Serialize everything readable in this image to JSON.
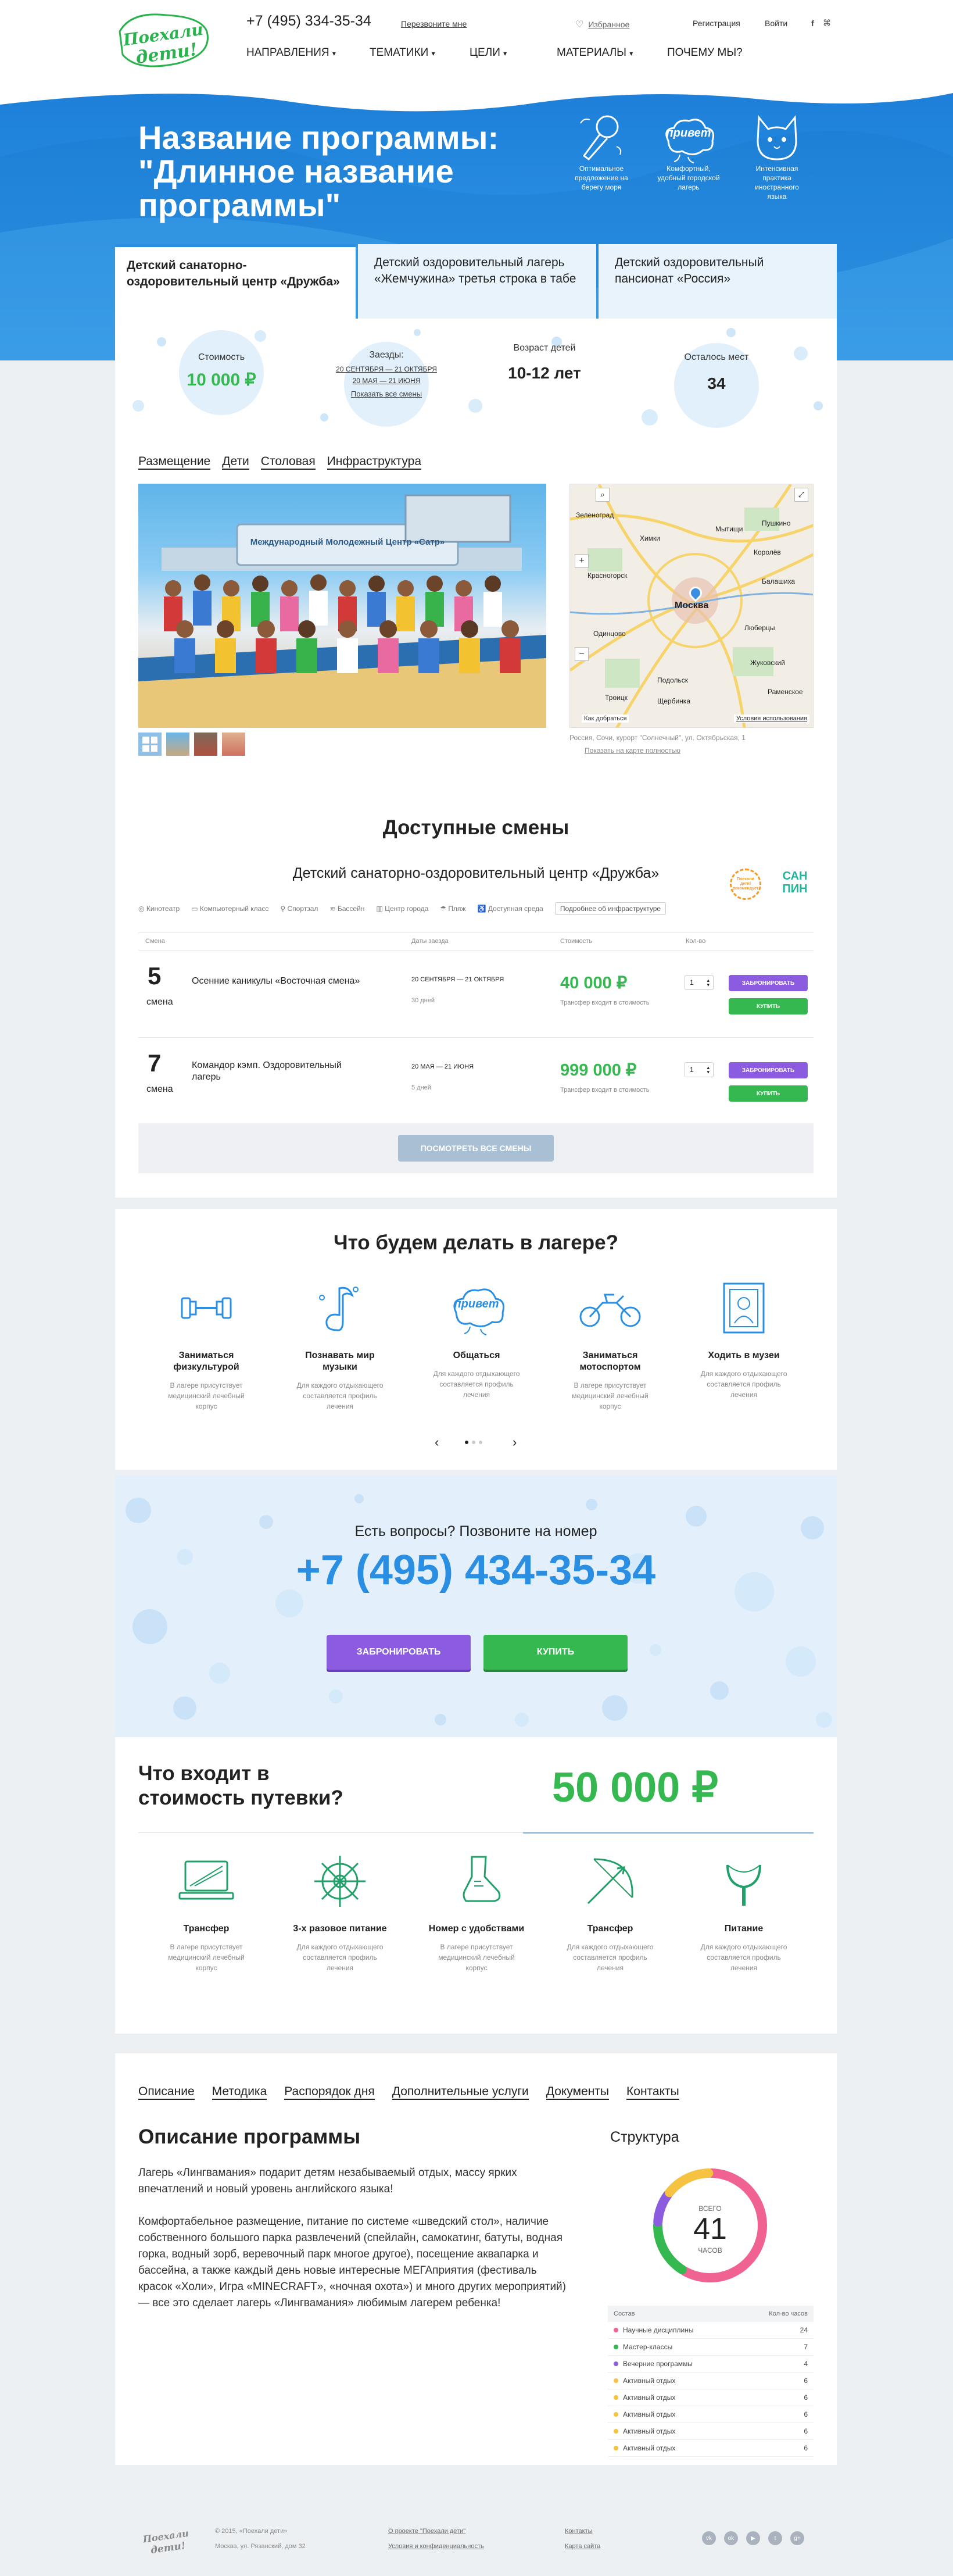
{
  "header": {
    "logo_text": "Поехали дети!",
    "phone": "+7 (495) 334-35-34",
    "callback": "Перезвоните мне",
    "favorites": "Избранное",
    "register": "Регистрация",
    "login": "Войти",
    "nav": [
      "НАПРАВЛЕНИЯ",
      "ТЕМАТИКИ",
      "ЦЕЛИ",
      "МАТЕРИАЛЫ",
      "ПОЧЕМУ МЫ?"
    ]
  },
  "hero": {
    "title": "Название программы: \"Длинное название программы\"",
    "features": [
      {
        "icon": "microphone-icon",
        "text": "Оптимальное предложение на берегу моря"
      },
      {
        "icon": "privet-cloud-icon",
        "badge": "привет",
        "text": "Комфортный, удобный городской лагерь"
      },
      {
        "icon": "cat-icon",
        "text": "Интенсивная практика иностранного языка"
      }
    ]
  },
  "tabs": [
    "Детский санаторно-оздоровительный центр «Дружба»",
    "Детский оздоровительный лагерь «Жемчужина» третья строка в табе",
    "Детский оздоровительный пансионат «Россия»"
  ],
  "stats": {
    "price_label": "Стоимость",
    "price_value": "10 000 ₽",
    "sessions_label": "Заезды:",
    "session_1": "20 СЕНТЯБРЯ — 21 ОКТЯБРЯ",
    "session_2": "20 МАЯ — 21 ИЮНЯ",
    "show_all": "Показать все смены",
    "age_label": "Возраст детей",
    "age_value": "10-12 лет",
    "places_label": "Осталось мест",
    "places_value": "34"
  },
  "sub_tabs": [
    "Размещение",
    "Дети",
    "Столовая",
    "Инфраструктура"
  ],
  "photo": {
    "banner": "Международный Молодежный Центр «Сатр»"
  },
  "map": {
    "address": "Россия, Сочи, курорт \"Солнечный\", ул. Октябрьская, 1",
    "link": "Показать на карте полностью",
    "labels": [
      "Зеленоград",
      "Мытищи",
      "Химки",
      "Пушкино",
      "Королёв",
      "Красногорск",
      "Балашиха",
      "Москва",
      "Одинцово",
      "Люберцы",
      "Жуковский",
      "Подольск",
      "Троицк",
      "Щербинка",
      "Раменское"
    ],
    "footer_left": "Как добраться",
    "footer_right": "Условия использования"
  },
  "shifts": {
    "title": "Доступные смены",
    "center_name": "Детский санаторно-оздоровительный центр «Дружба»",
    "amenities": [
      "Кинотеатр",
      "Компьютерный класс",
      "Спортзал",
      "Бассейн",
      "Центр города",
      "Пляж",
      "Доступная среда"
    ],
    "infra_button": "Подробнее об инфраструктуре",
    "badge_1": "Поехали дети! рекомендует",
    "badge_2": "САН ПИН",
    "columns": [
      "Смена",
      "",
      "Даты заезда",
      "Стоимость",
      "Кол-во"
    ],
    "rows": [
      {
        "num": "5",
        "word": "смена",
        "name": "Осенние каникулы «Восточная смена»",
        "dates": "20 СЕНТЯБРЯ — 21 ОКТЯБРЯ",
        "days": "30 дней",
        "price": "40 000 ₽",
        "note": "Трансфер входит в стоимость",
        "qty": "1"
      },
      {
        "num": "7",
        "word": "смена",
        "name": "Командор кэмп. Оздоровительный лагерь",
        "dates": "20 МАЯ — 21 ИЮНЯ",
        "days": "5 дней",
        "price": "999 000 ₽",
        "note": "Трансфер входит в стоимость",
        "qty": "1"
      }
    ],
    "book": "ЗАБРОНИРОВАТЬ",
    "buy": "КУПИТЬ",
    "all_button": "ПОСМОТРЕТЬ ВСЕ СМЕНЫ"
  },
  "activities": {
    "title": "Что будем делать в лагере?",
    "items": [
      {
        "icon": "dumbbell-icon",
        "title": "Заниматься физкультурой",
        "text": "В лагере присутствует медицинский лечебный корпус"
      },
      {
        "icon": "music-icon",
        "title": "Познавать мир музыки",
        "text": "Для каждого отдыхающего составляется профиль лечения"
      },
      {
        "icon": "privet-cloud-icon",
        "badge": "привет",
        "title": "Общаться",
        "text": "Для каждого отдыхающего составляется профиль лечения"
      },
      {
        "icon": "motorcycle-icon",
        "title": "Заниматься мотоспортом",
        "text": "В лагере присутствует медицинский лечебный корпус"
      },
      {
        "icon": "museum-icon",
        "title": "Ходить в музеи",
        "text": "Для каждого отдыхающего составляется профиль лечения"
      }
    ]
  },
  "contact": {
    "question": "Есть вопросы? Позвоните на номер",
    "phone": "+7 (495) 434-35-34",
    "book": "ЗАБРОНИРОВАТЬ",
    "buy": "КУПИТЬ"
  },
  "included": {
    "title": "Что входит в стоимость путевки?",
    "price": "50 000 ₽",
    "items": [
      {
        "icon": "monitor-icon",
        "title": "Трансфер",
        "text": "В лагере присутствует медицинский лечебный корпус"
      },
      {
        "icon": "wheel-icon",
        "title": "3-х разовое питание",
        "text": "Для каждого отдыхающего составляется профиль лечения"
      },
      {
        "icon": "sneaker-icon",
        "title": "Номер с удобствами",
        "text": "В лагере присутствует медицинский лечебный корпус"
      },
      {
        "icon": "bow-icon",
        "title": "Трансфер",
        "text": "Для каждого отдыхающего составляется профиль лечения"
      },
      {
        "icon": "slingshot-icon",
        "title": "Питание",
        "text": "Для каждого отдыхающего составляется профиль лечения"
      }
    ]
  },
  "program": {
    "tabs": [
      "Описание",
      "Методика",
      "Распорядок дня",
      "Дополнительные услуги",
      "Документы",
      "Контакты"
    ],
    "title": "Описание программы",
    "p1": "Лагерь «Лингвамания» подарит детям незабываемый отдых, массу ярких впечатлений и новый уровень английского языка!",
    "p2": "Комфортабельное размещение, питание по системе «шведский стол», наличие собственного большого парка развлечений (спейлайн, самокатинг, батуты, водная горка, водный зорб, веревочный парк многое другое), посещение аквапарка и бассейна, а также каждый день новые интересные МЕГАприятия (фестиваль красок «Холи», Игра «MINECRAFT», «ночная охота») и много других мероприятий) — все это сделает лагерь «Лингвамания» любимым лагерем ребенка!"
  },
  "structure": {
    "title": "Структура",
    "total_label": "ВСЕГО",
    "total": "41",
    "unit": "ЧАСОВ",
    "col1": "Состав",
    "col2": "Кол-во часов",
    "items": [
      {
        "name": "Научные дисциплины",
        "value": 24,
        "color": "#f06292"
      },
      {
        "name": "Мастер-классы",
        "value": 7,
        "color": "#35b84f"
      },
      {
        "name": "Вечерние программы",
        "value": 4,
        "color": "#8c5ce0"
      },
      {
        "name": "Активный отдых",
        "value": 6,
        "color": "#f5c242"
      },
      {
        "name": "Активный отдых",
        "value": 6,
        "color": "#f5c242"
      },
      {
        "name": "Активный отдых",
        "value": 6,
        "color": "#f5c242"
      },
      {
        "name": "Активный отдых",
        "value": 6,
        "color": "#f5c242"
      },
      {
        "name": "Активный отдых",
        "value": 6,
        "color": "#f5c242"
      }
    ]
  },
  "footer": {
    "copyright": "© 2015, «Поехали дети»",
    "address": "Москва, ул. Рязанский, дом 32",
    "link1": "О проекте \"Поехали дети\"",
    "link2": "Условия и конфиденциальность",
    "link3": "Контакты",
    "link4": "Карта сайта",
    "social": [
      "vk",
      "ok",
      "youtube",
      "twitter",
      "google-plus"
    ]
  }
}
